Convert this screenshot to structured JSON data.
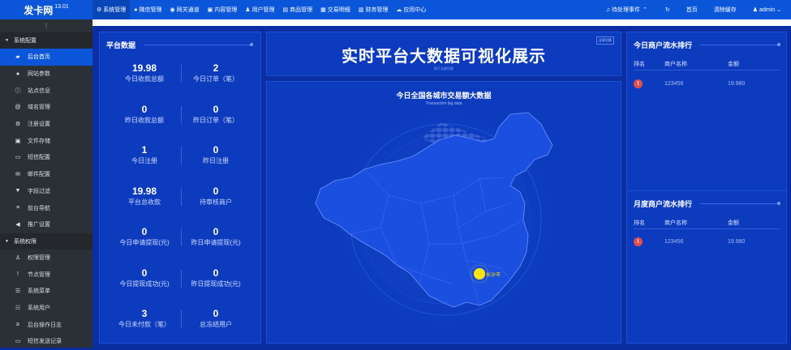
{
  "brand": {
    "name": "发卡网",
    "version": "13.01"
  },
  "topnav": [
    {
      "icon": "gear-icon",
      "glyph": "⚙",
      "label": "系统管理",
      "active": true
    },
    {
      "icon": "wechat-icon",
      "glyph": "●",
      "label": "微信管理",
      "active": false
    },
    {
      "icon": "gateway-icon",
      "glyph": "◉",
      "label": "网关通道",
      "active": false
    },
    {
      "icon": "content-icon",
      "glyph": "▣",
      "label": "内容管理",
      "active": false
    },
    {
      "icon": "users-icon",
      "glyph": "♟",
      "label": "用户管理",
      "active": false
    },
    {
      "icon": "goods-icon",
      "glyph": "▤",
      "label": "商品管理",
      "active": false
    },
    {
      "icon": "trade-icon",
      "glyph": "▦",
      "label": "交易明细",
      "active": false
    },
    {
      "icon": "finance-icon",
      "glyph": "▥",
      "label": "财务管理",
      "active": false
    },
    {
      "icon": "cloud-icon",
      "glyph": "☁",
      "label": "应用中心",
      "active": false
    }
  ],
  "topright": {
    "pending": "待处理事件",
    "refresh_glyph": "↻",
    "home": "首页",
    "clear_cache": "清除缓存",
    "user": "admin"
  },
  "sidebar": {
    "groups": [
      {
        "label": "系统配置",
        "items": [
          {
            "label": "后台首页",
            "icon": "chart-icon",
            "glyph": "▰",
            "active": true
          },
          {
            "label": "网站参数",
            "icon": "apple-icon",
            "glyph": "●",
            "active": false
          },
          {
            "label": "站点信息",
            "icon": "info-icon",
            "glyph": "ⓘ",
            "active": false
          },
          {
            "label": "域名管理",
            "icon": "at-icon",
            "glyph": "@",
            "active": false
          },
          {
            "label": "注册设置",
            "icon": "gear-icon",
            "glyph": "⚙",
            "active": false
          },
          {
            "label": "文件存储",
            "icon": "save-icon",
            "glyph": "▣",
            "active": false
          },
          {
            "label": "短信配置",
            "icon": "sms-icon",
            "glyph": "▭",
            "active": false
          },
          {
            "label": "邮件配置",
            "icon": "mail-icon",
            "glyph": "✉",
            "active": false
          },
          {
            "label": "字段过滤",
            "icon": "filter-icon",
            "glyph": "▼",
            "active": false
          },
          {
            "label": "前台导航",
            "icon": "list-icon",
            "glyph": "≡",
            "active": false
          },
          {
            "label": "推广设置",
            "icon": "megaphone-icon",
            "glyph": "◀",
            "active": false
          }
        ]
      },
      {
        "label": "系统权限",
        "items": [
          {
            "label": "权限管理",
            "icon": "user-lock-icon",
            "glyph": "♙",
            "active": false
          },
          {
            "label": "节点管理",
            "icon": "exclamation-icon",
            "glyph": "!",
            "active": false
          },
          {
            "label": "系统菜单",
            "icon": "menu-icon",
            "glyph": "☰",
            "active": false
          },
          {
            "label": "系统用户",
            "icon": "user-list-icon",
            "glyph": "☷",
            "active": false
          },
          {
            "label": "后台操作日志",
            "icon": "terminal-icon",
            "glyph": "≥",
            "active": false
          },
          {
            "label": "短信发送记录",
            "icon": "sms-log-icon",
            "glyph": "▭",
            "active": false
          }
        ]
      }
    ]
  },
  "platform": {
    "title": "平台数据",
    "stats": [
      {
        "value": "19.98",
        "label": "今日收款总额"
      },
      {
        "value": "2",
        "label": "今日订单（笔）"
      },
      {
        "value": "0",
        "label": "昨日收款总额"
      },
      {
        "value": "0",
        "label": "昨日订单（笔）"
      },
      {
        "value": "1",
        "label": "今日注册"
      },
      {
        "value": "0",
        "label": "昨日注册"
      },
      {
        "value": "19.98",
        "label": "平台总收款"
      },
      {
        "value": "0",
        "label": "待审核商户"
      },
      {
        "value": "0",
        "label": "今日申请提现(元)"
      },
      {
        "value": "0",
        "label": "昨日申请提现(元)"
      },
      {
        "value": "0",
        "label": "今日提现成功(元)"
      },
      {
        "value": "0",
        "label": "昨日提现成功(元)"
      },
      {
        "value": "3",
        "label": "今日未付款（笔）"
      },
      {
        "value": "0",
        "label": "总冻结用户"
      }
    ]
  },
  "center": {
    "title": "实时平台大数据可视化展示",
    "subtitle": "按下全屏切换",
    "fullscreen": "全屏切换",
    "map_title": "今日全国各城市交易额大数据",
    "map_subtitle": "Transaction big data",
    "city": "长沙市"
  },
  "today_rank": {
    "title": "今日商户流水排行",
    "headers": [
      "排名",
      "商户名称",
      "金额"
    ],
    "rows": [
      {
        "rank": "!",
        "name": "123456",
        "amount": "19.980"
      }
    ]
  },
  "month_rank": {
    "title": "月度商户流水排行",
    "headers": [
      "排名",
      "商户名称",
      "金额"
    ],
    "rows": [
      {
        "rank": "!",
        "name": "123456",
        "amount": "19.980"
      }
    ]
  },
  "colors": {
    "accent": "#0b56d8",
    "sidebar_bg": "#2b3036",
    "panel_bg": "#0d3bbd",
    "badge": "#e05050",
    "city_dot": "#ffe600"
  }
}
